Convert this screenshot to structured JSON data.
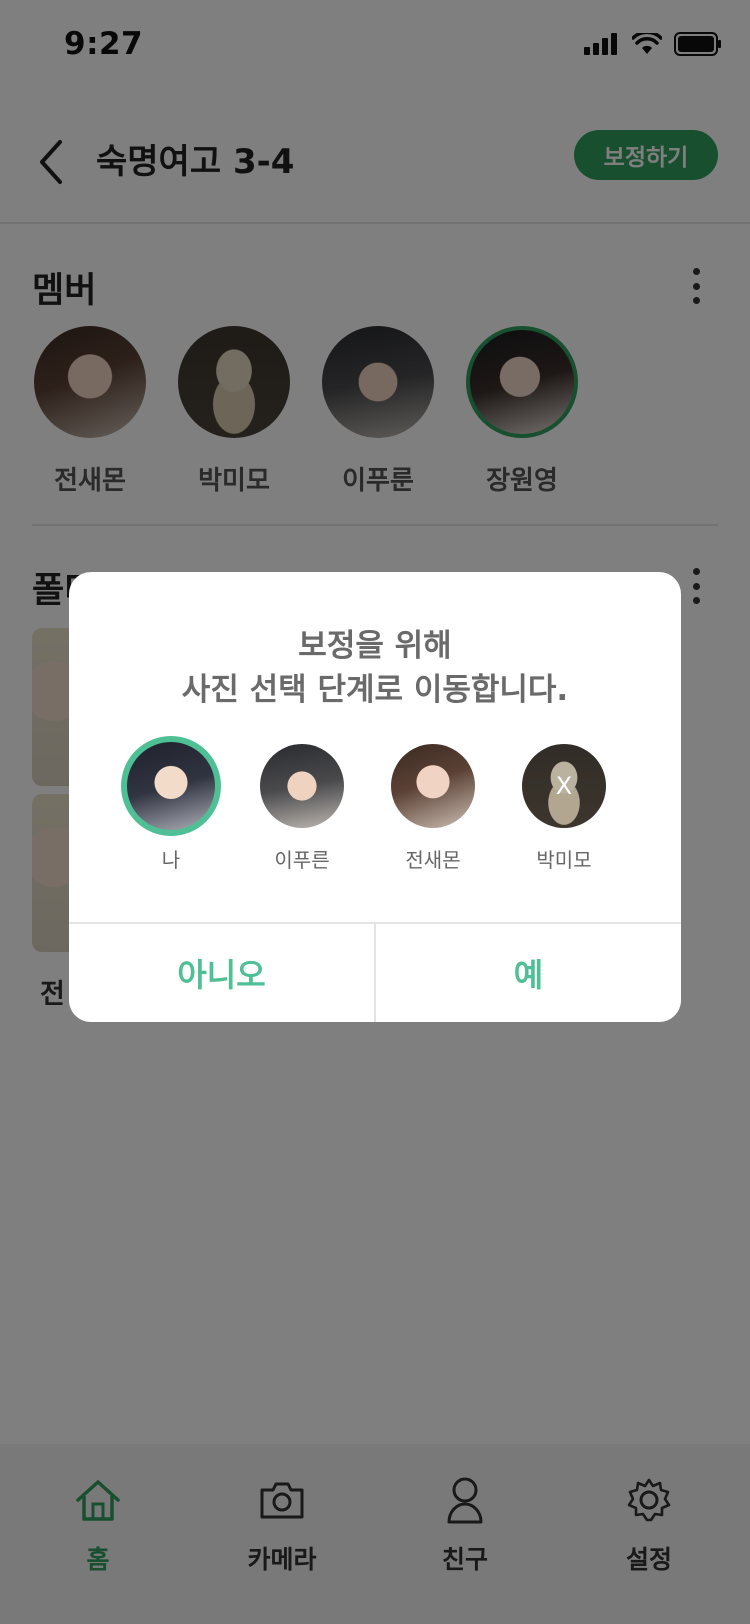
{
  "status_bar": {
    "time": "9:27"
  },
  "header": {
    "title": "숙명여고 3-4",
    "adjust_label": "보정하기"
  },
  "members_section": {
    "title": "멤버",
    "members": [
      {
        "name": "전새몬"
      },
      {
        "name": "박미모"
      },
      {
        "name": "이푸룬"
      },
      {
        "name": "장원영"
      }
    ]
  },
  "album_section": {
    "title": "폴더",
    "caption": "전"
  },
  "dialog": {
    "title_line1": "보정을 위해",
    "title_line2": "사진 선택 단계로 이동합니다.",
    "people": [
      {
        "name": "나"
      },
      {
        "name": "이푸른"
      },
      {
        "name": "전새몬"
      },
      {
        "name": "박미모",
        "remove_mark": "X"
      }
    ],
    "no_label": "아니오",
    "yes_label": "예"
  },
  "tab_bar": {
    "tabs": [
      {
        "label": "홈",
        "icon": "home-icon",
        "active": true
      },
      {
        "label": "카메라",
        "icon": "camera-icon"
      },
      {
        "label": "친구",
        "icon": "person-icon"
      },
      {
        "label": "설정",
        "icon": "gear-icon"
      }
    ]
  },
  "colors": {
    "accent": "#2f9e5e",
    "dialog_accent": "#4fbf95",
    "overlay": "rgba(0,0,0,0.5)"
  }
}
